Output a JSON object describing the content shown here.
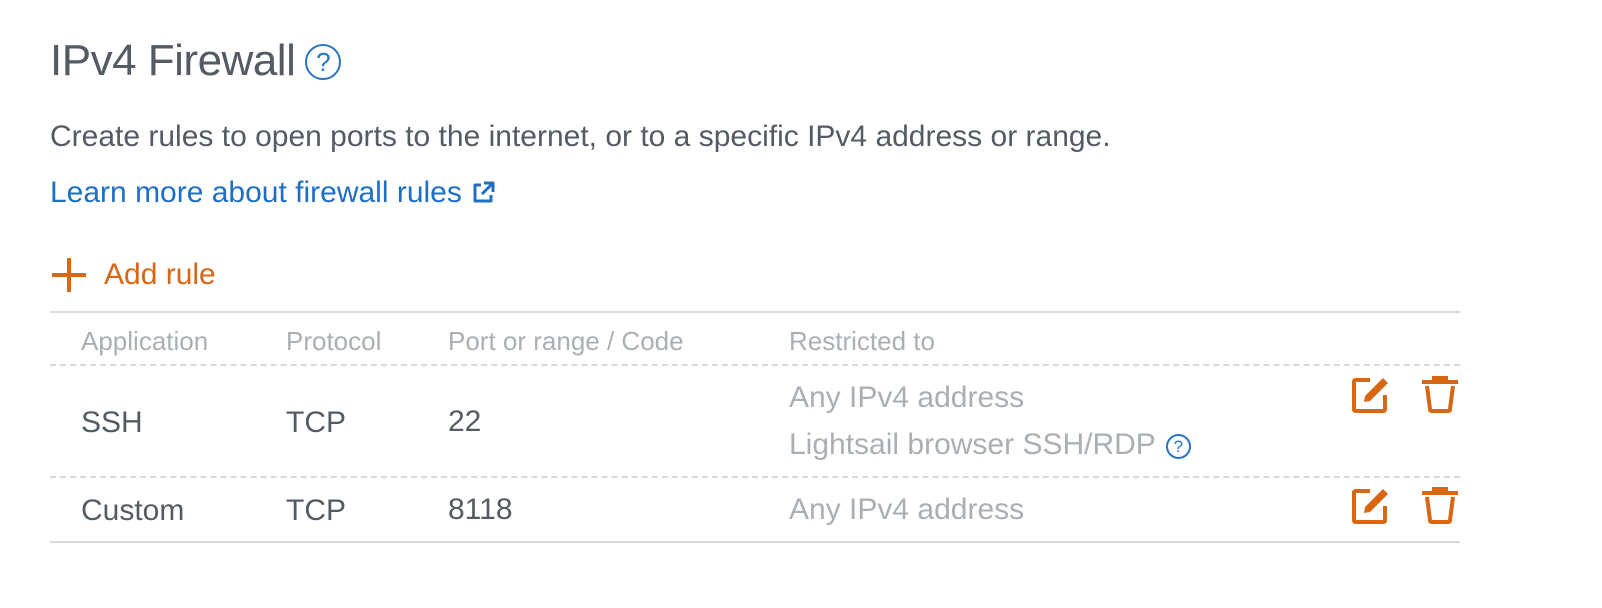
{
  "header": {
    "title": "IPv4 Firewall",
    "help_glyph": "?"
  },
  "description": "Create rules to open ports to the internet, or to a specific IPv4 address or range.",
  "learn_more": {
    "label": "Learn more about firewall rules",
    "icon": "external-link-icon"
  },
  "add_rule": {
    "label": "Add rule",
    "icon": "plus-icon"
  },
  "table": {
    "columns": [
      "Application",
      "Protocol",
      "Port or range / Code",
      "Restricted to"
    ],
    "rows": [
      {
        "application": "SSH",
        "protocol": "TCP",
        "port": "22",
        "restricted": [
          "Any IPv4 address",
          "Lightsail browser SSH/RDP"
        ],
        "restricted_help": "?"
      },
      {
        "application": "Custom",
        "protocol": "TCP",
        "port": "8118",
        "restricted": [
          "Any IPv4 address"
        ]
      }
    ],
    "row_actions": [
      "edit-icon",
      "trash-icon"
    ]
  },
  "colors": {
    "accent_orange": "#d86613",
    "link_blue": "#1f6fc5",
    "text": "#545b64",
    "muted": "#a9afb3",
    "divider": "#d5dbdb"
  }
}
